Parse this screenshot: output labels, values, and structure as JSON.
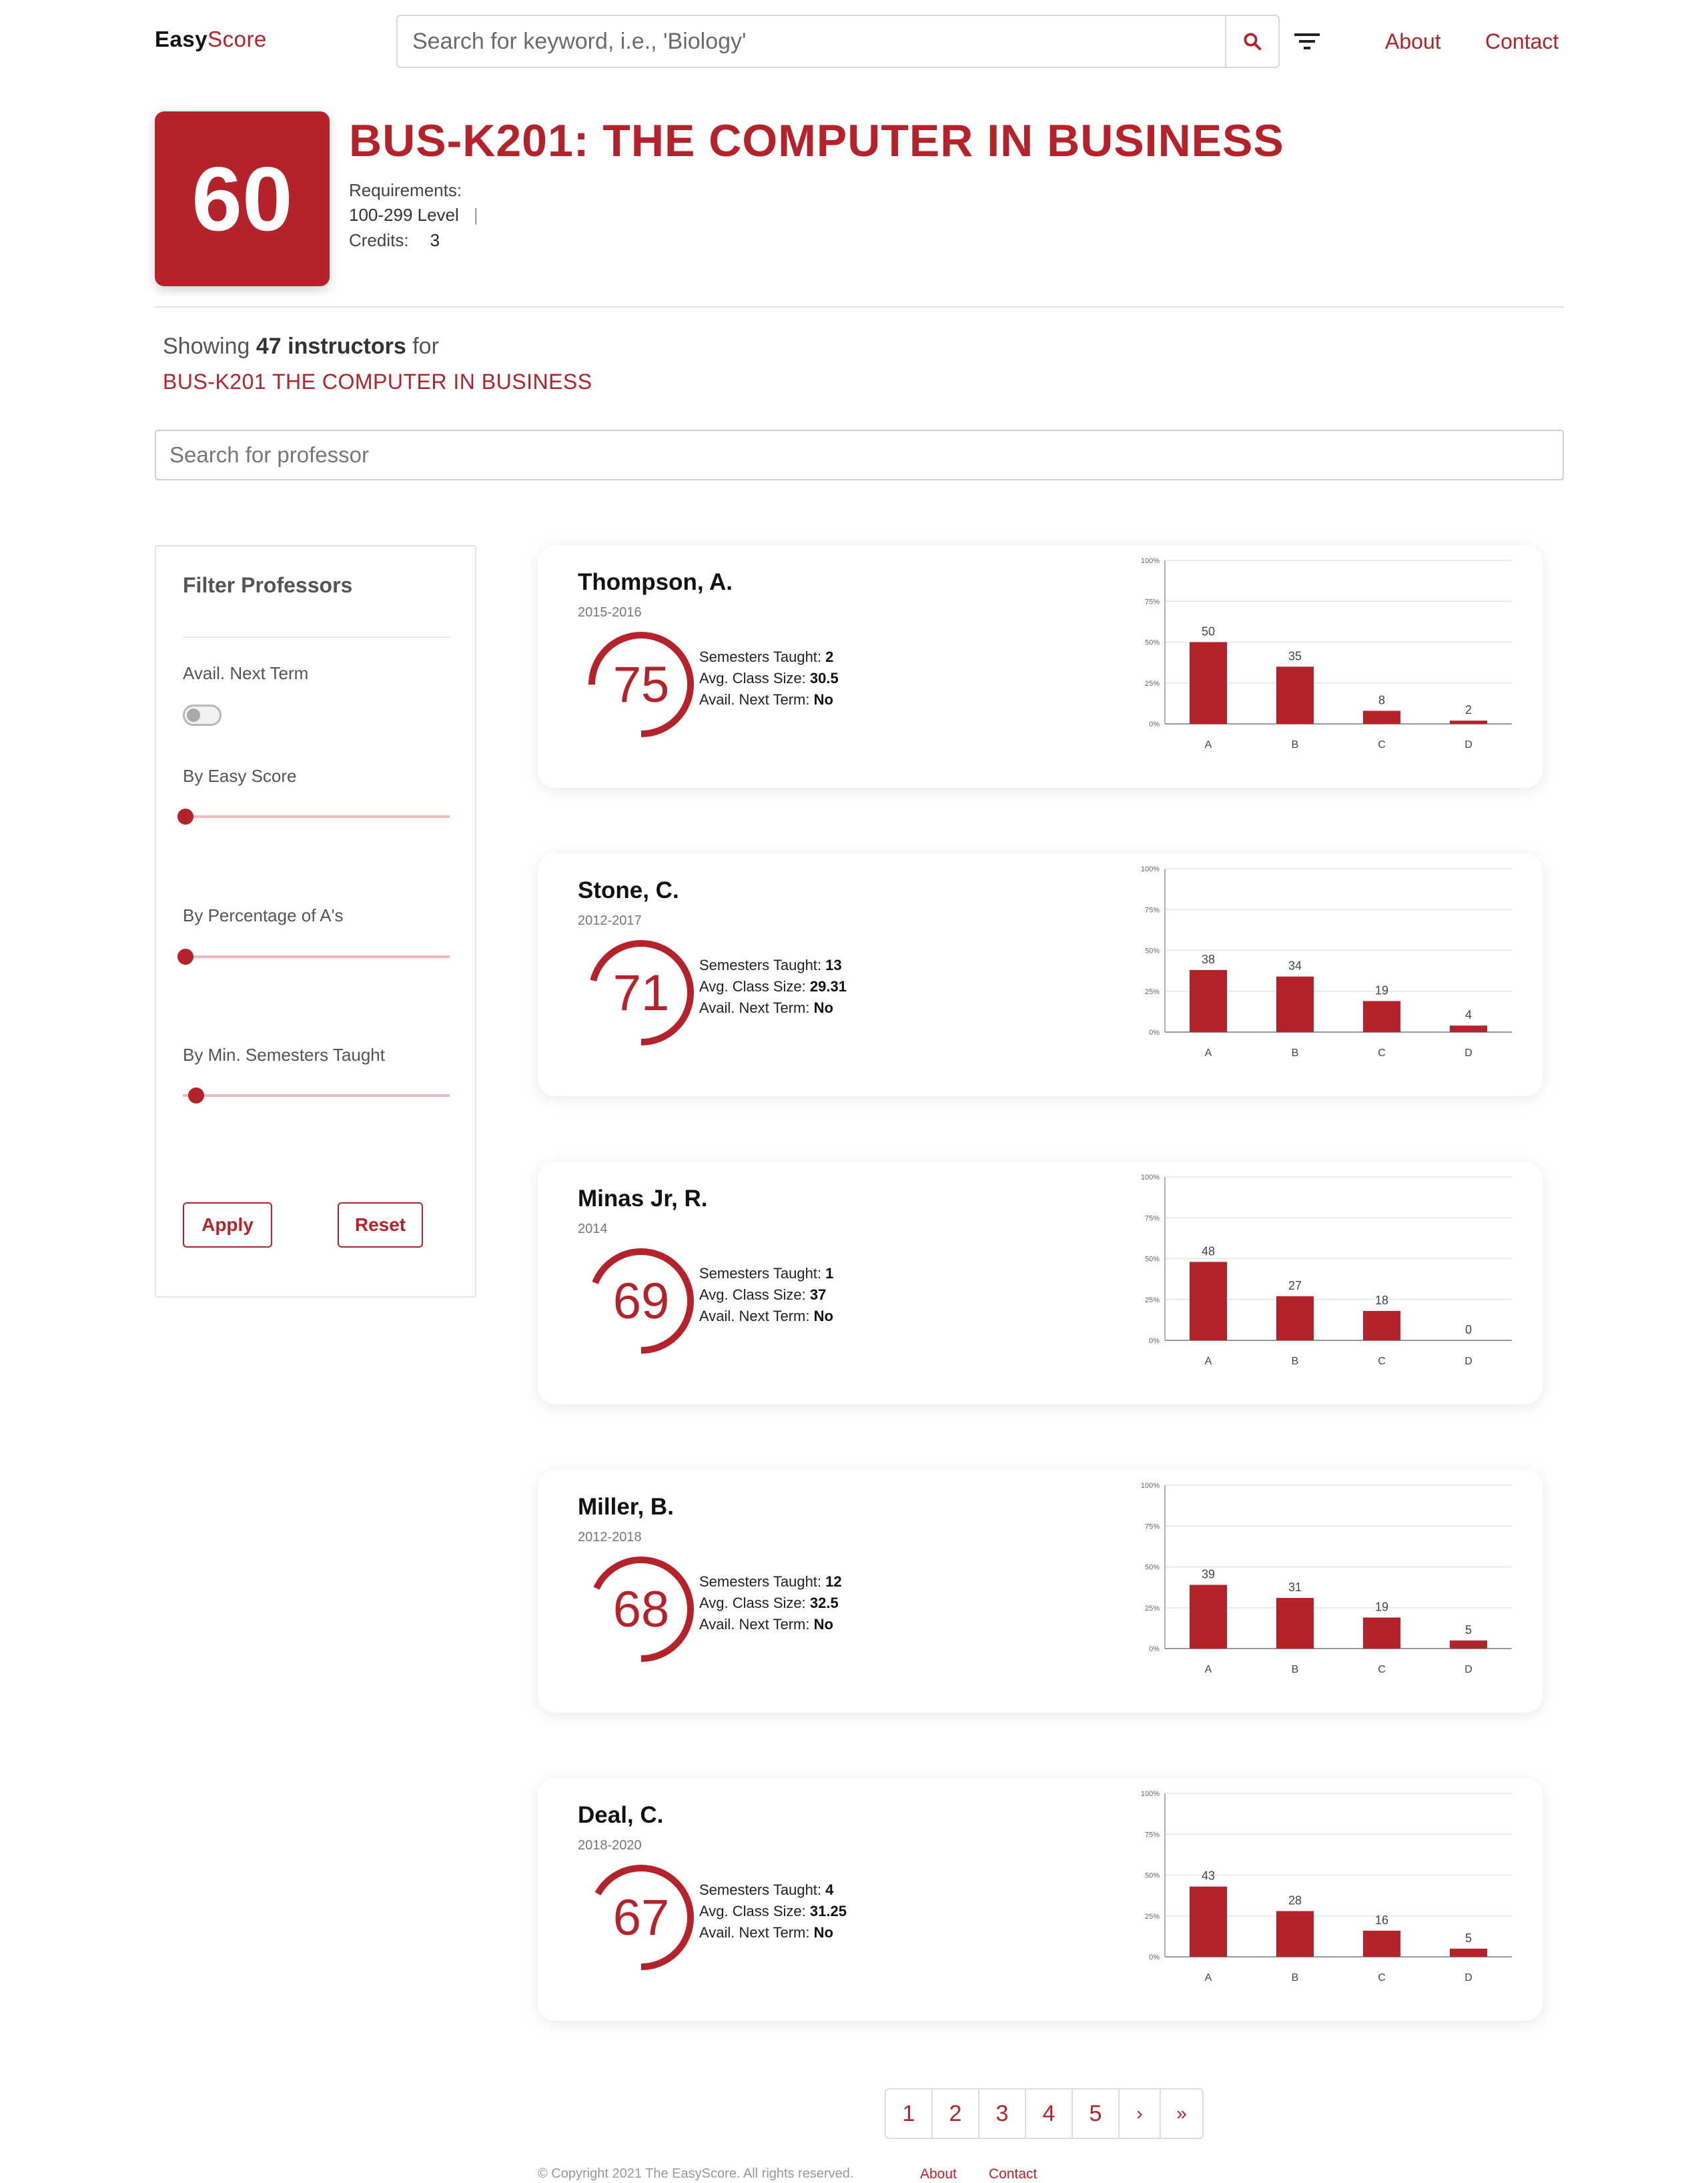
{
  "brand": {
    "easy": "Easy",
    "score": "Score"
  },
  "search": {
    "placeholder": "Search for keyword, i.e., 'Biology'"
  },
  "nav": {
    "about": "About",
    "contact": "Contact"
  },
  "course": {
    "score": "60",
    "title": "BUS-K201: THE COMPUTER IN BUSINESS",
    "requirements_label": "Requirements:",
    "level": "100-299 Level",
    "level_sep": "|",
    "credits_label": "Credits:",
    "credits": "3"
  },
  "listing": {
    "showing_prefix": "Showing",
    "count_text": "47 instructors",
    "showing_suffix": "for",
    "course_link": "BUS-K201 THE COMPUTER IN BUSINESS",
    "prof_search_placeholder": "Search for professor"
  },
  "filters": {
    "title": "Filter Professors",
    "avail_label": "Avail. Next Term",
    "avail_on": false,
    "easy_label": "By Easy Score",
    "easy_value": 0,
    "pct_a_label": "By Percentage of A's",
    "pct_a_value": 0,
    "min_sem_label": "By Min. Semesters Taught",
    "min_sem_value": 0.04,
    "apply": "Apply",
    "reset": "Reset"
  },
  "card_labels": {
    "semesters": "Semesters Taught:",
    "class_size": "Avg. Class Size:",
    "avail": "Avail. Next Term:"
  },
  "professors": [
    {
      "name": "Thompson, A.",
      "years": "2015-2016",
      "score": "75",
      "semesters": "2",
      "class_size": "30.5",
      "avail": "No"
    },
    {
      "name": "Stone, C.",
      "years": "2012-2017",
      "score": "71",
      "semesters": "13",
      "class_size": "29.31",
      "avail": "No"
    },
    {
      "name": "Minas Jr, R.",
      "years": "2014",
      "score": "69",
      "semesters": "1",
      "class_size": "37",
      "avail": "No"
    },
    {
      "name": "Miller, B.",
      "years": "2012-2018",
      "score": "68",
      "semesters": "12",
      "class_size": "32.5",
      "avail": "No"
    },
    {
      "name": "Deal, C.",
      "years": "2018-2020",
      "score": "67",
      "semesters": "4",
      "class_size": "31.25",
      "avail": "No"
    }
  ],
  "chart_data": [
    {
      "type": "bar",
      "categories": [
        "A",
        "B",
        "C",
        "D"
      ],
      "values": [
        50,
        35,
        8,
        2
      ],
      "ylim": [
        0,
        100
      ],
      "yticks": [
        "0%",
        "25%",
        "50%",
        "75%",
        "100%"
      ],
      "grid": true
    },
    {
      "type": "bar",
      "categories": [
        "A",
        "B",
        "C",
        "D"
      ],
      "values": [
        38,
        34,
        19,
        4
      ],
      "ylim": [
        0,
        100
      ],
      "yticks": [
        "0%",
        "25%",
        "50%",
        "75%",
        "100%"
      ],
      "grid": true
    },
    {
      "type": "bar",
      "categories": [
        "A",
        "B",
        "C",
        "D"
      ],
      "values": [
        48,
        27,
        18,
        0
      ],
      "ylim": [
        0,
        100
      ],
      "yticks": [
        "0%",
        "25%",
        "50%",
        "75%",
        "100%"
      ],
      "grid": true
    },
    {
      "type": "bar",
      "categories": [
        "A",
        "B",
        "C",
        "D"
      ],
      "values": [
        39,
        31,
        19,
        5
      ],
      "ylim": [
        0,
        100
      ],
      "yticks": [
        "0%",
        "25%",
        "50%",
        "75%",
        "100%"
      ],
      "grid": true
    },
    {
      "type": "bar",
      "categories": [
        "A",
        "B",
        "C",
        "D"
      ],
      "values": [
        43,
        28,
        16,
        5
      ],
      "ylim": [
        0,
        100
      ],
      "yticks": [
        "0%",
        "25%",
        "50%",
        "75%",
        "100%"
      ],
      "grid": true
    }
  ],
  "pagination": {
    "pages": [
      "1",
      "2",
      "3",
      "4",
      "5"
    ],
    "next": "›",
    "last": "»"
  },
  "footer": {
    "copyright": "© Copyright 2021 The EasyScore. All rights reserved.",
    "about": "About",
    "contact": "Contact"
  },
  "colors": {
    "accent": "#b5222a",
    "slider_track": "#f2b9bd",
    "grid": "#e6e6e6"
  }
}
